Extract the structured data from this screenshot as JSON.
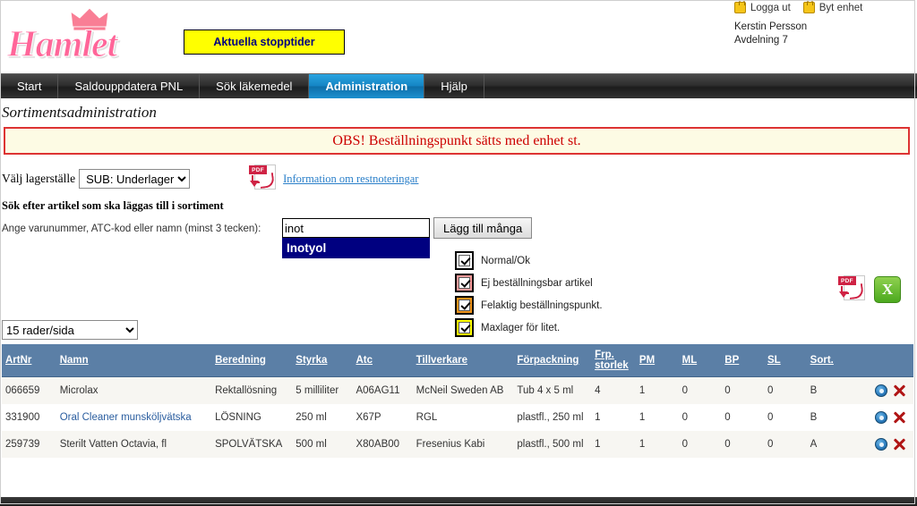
{
  "header": {
    "logo_text": "Hamlet",
    "logo_icon": "crown-icon",
    "stopptider_button": "Aktuella stopptider",
    "logout_label": "Logga ut",
    "switch_unit_label": "Byt enhet",
    "user_name": "Kerstin Persson",
    "user_department": "Avdelning 7"
  },
  "nav": {
    "tabs": [
      {
        "label": "Start",
        "active": false
      },
      {
        "label": "Saldouppdatera PNL",
        "active": false
      },
      {
        "label": "Sök läkemedel",
        "active": false
      },
      {
        "label": "Administration",
        "active": true
      },
      {
        "label": "Hjälp",
        "active": false
      }
    ]
  },
  "page": {
    "title": "Sortimentsadministration",
    "warning": "OBS! Beställningspunkt sätts med enhet st."
  },
  "warehouse": {
    "label": "Välj lagerställe",
    "selected": "SUB: Underlager",
    "options": [
      "SUB: Underlager"
    ],
    "pdf_icon": "pdf-icon",
    "pdf_link_text": "Information om restnoteringar"
  },
  "search": {
    "heading": "Sök efter artikel som ska läggas till i sortiment",
    "label": "Ange varunummer, ATC-kod eller namn (minst 3 tecken):",
    "value": "inot",
    "placeholder": "",
    "clear_icon": "close-icon",
    "suggestions": [
      "Inotyol"
    ],
    "add_many_button": "Lägg till många"
  },
  "legend": {
    "items": [
      {
        "label": "Normal/Ok",
        "color": "#ffffff",
        "checked": true
      },
      {
        "label": "Ej beställningsbar artikel",
        "color": "#f89a9a",
        "checked": true
      },
      {
        "label": "Felaktig beställningspunkt.",
        "color": "#f0941a",
        "checked": true
      },
      {
        "label": "Maxlager för litet.",
        "color": "#ffff00",
        "checked": true
      }
    ]
  },
  "export": {
    "pdf_icon": "pdf-export-icon",
    "excel_icon": "excel-export-icon",
    "excel_glyph": "X"
  },
  "paging": {
    "rows_per_page_selected": "15 rader/sida",
    "options": [
      "15 rader/sida"
    ]
  },
  "table": {
    "columns": [
      "ArtNr",
      "Namn",
      "Beredning",
      "Styrka",
      "Atc",
      "Tillverkare",
      "Förpackning",
      "Frp. storlek",
      "PM",
      "ML",
      "BP",
      "SL",
      "Sort."
    ],
    "rows": [
      {
        "artnr": "066659",
        "namn": "Microlax",
        "namn_is_link": false,
        "beredning": "Rektallösning",
        "styrka": "5 milliliter",
        "atc": "A06AG11",
        "tillverkare": "McNeil Sweden AB",
        "forpackning": "Tub 4 x 5 ml",
        "frp_storlek": "4",
        "pm": "1",
        "ml": "0",
        "bp": "0",
        "sl": "0",
        "sort": "B",
        "edit_icon": "gear-icon",
        "delete_icon": "delete-x-icon"
      },
      {
        "artnr": "331900",
        "namn": "Oral Cleaner munsköljvätska",
        "namn_is_link": true,
        "beredning": "LÖSNING",
        "styrka": "250 ml",
        "atc": "X67P",
        "tillverkare": "RGL",
        "forpackning": "plastfl., 250 ml",
        "frp_storlek": "1",
        "pm": "1",
        "ml": "0",
        "bp": "0",
        "sl": "0",
        "sort": "B",
        "edit_icon": "gear-icon",
        "delete_icon": "delete-x-icon"
      },
      {
        "artnr": "259739",
        "namn": "Sterilt Vatten Octavia, fl",
        "namn_is_link": false,
        "beredning": "SPOLVÄTSKA",
        "styrka": "500 ml",
        "atc": "X80AB00",
        "tillverkare": "Fresenius Kabi",
        "forpackning": "plastfl., 500 ml",
        "frp_storlek": "1",
        "pm": "1",
        "ml": "0",
        "bp": "0",
        "sl": "0",
        "sort": "A",
        "edit_icon": "gear-icon",
        "delete_icon": "delete-x-icon"
      }
    ]
  },
  "colors": {
    "accent_blue": "#1484c4",
    "table_header": "#5b7fa6",
    "warning_red": "#cc0000",
    "logo_pink": "#ff6699",
    "highlight_yellow": "#ffff00"
  }
}
